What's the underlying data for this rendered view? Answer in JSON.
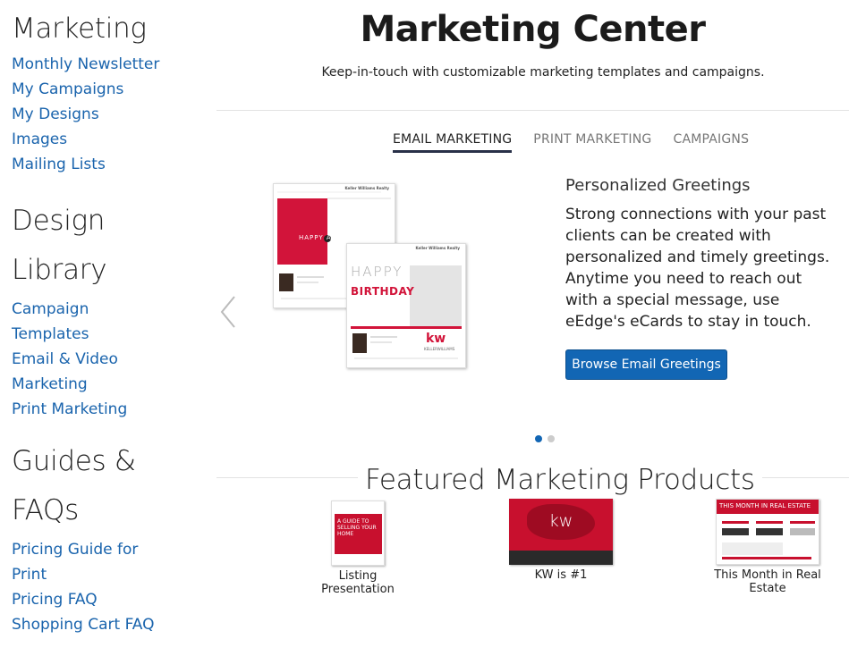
{
  "sidebar": {
    "marketing_heading": "Marketing",
    "marketing_links": [
      "Monthly Newsletter",
      "My Campaigns",
      "My Designs",
      "Images",
      "Mailing Lists"
    ],
    "design_heading_1": "Design",
    "design_heading_2": "Library",
    "design_links": [
      "Campaign",
      "Templates",
      "Email & Video",
      "Marketing",
      "Print Marketing"
    ],
    "guides_heading_1": "Guides &",
    "guides_heading_2": "FAQs",
    "guides_links": [
      "Pricing Guide for",
      "Print",
      "Pricing FAQ",
      "Shopping Cart FAQ"
    ]
  },
  "header": {
    "title": "Marketing Center",
    "subtitle": "Keep-in-touch with customizable marketing templates and campaigns."
  },
  "tabs": [
    "EMAIL MARKETING",
    "PRINT MARKETING",
    "CAMPAIGNS"
  ],
  "slide": {
    "title": "Personalized Greetings",
    "text": "Strong connections with your past clients can be created with personalized and timely greetings. Anytime you need to reach out with a special message, use eEdge's eCards to stay in touch.",
    "button": "Browse Email Greetings",
    "card1_text": "HAPPY ANNIVERSARY",
    "card2_line1": "HAPPY",
    "card2_line2": "BIRTHDAY",
    "brand": "Keller Williams Realty",
    "logo": "kw",
    "logo_sub": "KELLERWILLIAMS",
    "active_dot": 1,
    "dot_count": 2
  },
  "featured": {
    "title": "Featured Marketing Products",
    "products": [
      {
        "label": "Listing Presentation",
        "thumb_text": "A GUIDE TO SELLING YOUR HOME"
      },
      {
        "label": "KW is #1",
        "thumb_text": "kw"
      },
      {
        "label": "This Month in Real Estate",
        "thumb_text": "THIS MONTH IN REAL ESTATE"
      }
    ]
  },
  "colors": {
    "link": "#1a64ad",
    "accent_red": "#d2143a",
    "button": "#1266b4",
    "tab_underline": "#283048"
  },
  "icons": [
    "chevron-left-icon",
    "kw-logo-icon"
  ]
}
